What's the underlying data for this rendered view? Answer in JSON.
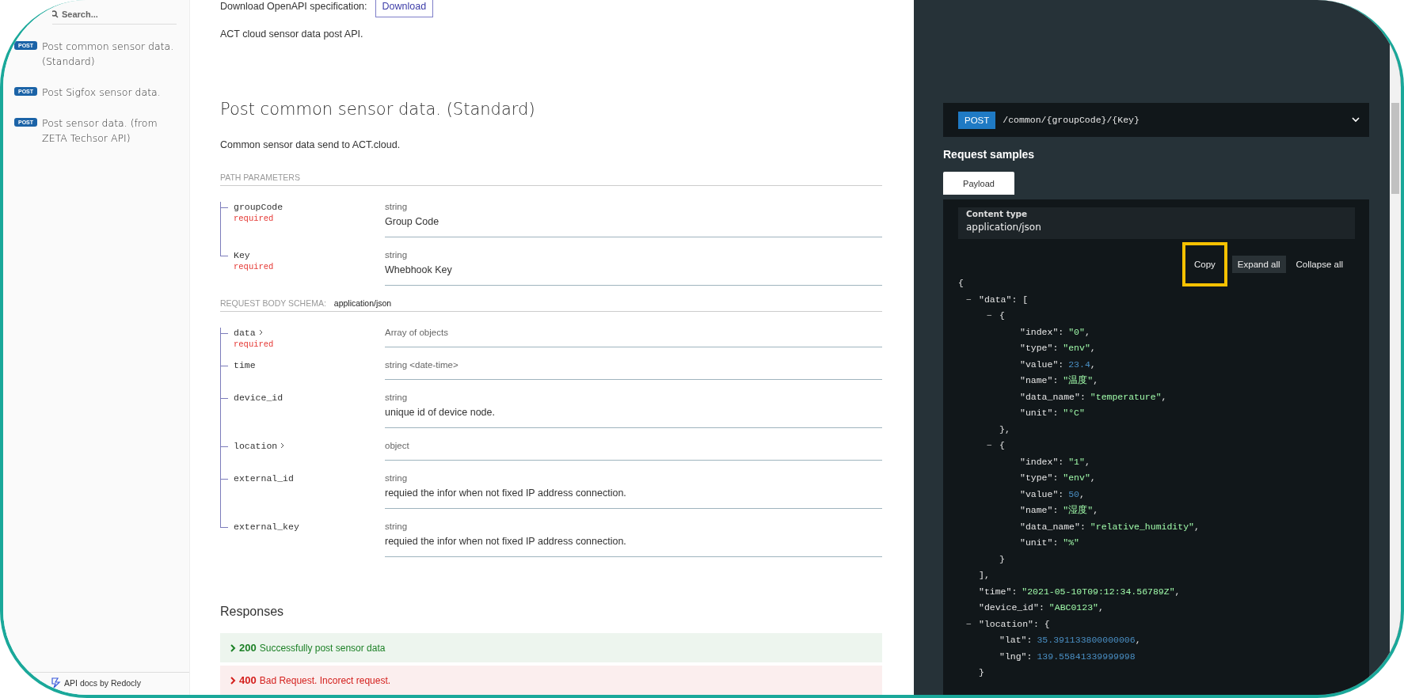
{
  "sidebar": {
    "search": {
      "placeholder": "Search..."
    },
    "items": [
      {
        "method": "POST",
        "label": "Post common sensor data. (Standard)",
        "selected": false
      },
      {
        "method": "POST",
        "label": "Post Sigfox sensor data.",
        "selected": false
      },
      {
        "method": "POST",
        "label": "Post sensor data. (from ZETA Techsor API)",
        "selected": false
      }
    ],
    "footer": "API docs by Redocly"
  },
  "main": {
    "download_label": "Download OpenAPI specification:",
    "download_button": "Download",
    "intro": "ACT cloud sensor data post API.",
    "operation_title": "Post common sensor data. (Standard)",
    "operation_description": "Common sensor data send to ACT.cloud.",
    "path_parameters": {
      "title": "PATH PARAMETERS",
      "params": [
        {
          "name": "groupCode",
          "required": true,
          "required_label": "required",
          "type": "string",
          "description": "Group Code",
          "expandable": false
        },
        {
          "name": "Key",
          "required": true,
          "required_label": "required",
          "type": "string",
          "description": "Whebhook Key",
          "expandable": false
        }
      ]
    },
    "body_schema": {
      "title": "REQUEST BODY SCHEMA:",
      "content_type": "application/json",
      "params": [
        {
          "name": "data",
          "required": true,
          "required_label": "required",
          "type": "Array of objects",
          "expandable": true
        },
        {
          "name": "time",
          "type": "string <date-time>",
          "expandable": false
        },
        {
          "name": "device_id",
          "type": "string",
          "description": "unique id of device node.",
          "expandable": false
        },
        {
          "name": "location",
          "type": "object",
          "expandable": true
        },
        {
          "name": "external_id",
          "type": "string",
          "description": "requied the infor when not fixed IP address connection.",
          "expandable": false
        },
        {
          "name": "external_key",
          "type": "string",
          "description": "requied the infor when not fixed IP address connection.",
          "expandable": false
        }
      ]
    },
    "responses": {
      "title": "Responses",
      "items": [
        {
          "kind": "success",
          "code": "200",
          "text": "Successfully post sensor data"
        },
        {
          "kind": "error",
          "code": "400",
          "text": "Bad Request. Incorect request."
        }
      ]
    }
  },
  "panel": {
    "endpoint": {
      "method": "POST",
      "path": "/common/{groupCode}/{Key}"
    },
    "samples_title": "Request samples",
    "tabs": [
      {
        "label": "Payload",
        "selected": true
      }
    ],
    "content_type_label": "Content type",
    "content_type": "application/json",
    "actions": [
      {
        "label": "Copy",
        "highlighted": true
      },
      {
        "label": "Expand all",
        "highlighted": false
      },
      {
        "label": "Collapse all",
        "highlighted": false
      }
    ],
    "code": {
      "open": "{",
      "children": [
        {
          "toggle": "−",
          "open": "\"data\": [",
          "close": "],",
          "children": [
            {
              "toggle": "−",
              "open": "{",
              "close": "},",
              "children": [
                {
                  "key": "\"index\":",
                  "value": "\"0\"",
                  "kind": "string",
                  "trail": ","
                },
                {
                  "key": "\"type\":",
                  "value": "\"env\"",
                  "kind": "string",
                  "trail": ","
                },
                {
                  "key": "\"value\":",
                  "value": "23.4",
                  "kind": "number",
                  "trail": ","
                },
                {
                  "key": "\"name\":",
                  "value": "\"温度\"",
                  "kind": "string",
                  "trail": ","
                },
                {
                  "key": "\"data_name\":",
                  "value": "\"temperature\"",
                  "kind": "string",
                  "trail": ","
                },
                {
                  "key": "\"unit\":",
                  "value": "\"°C\"",
                  "kind": "string"
                }
              ]
            },
            {
              "toggle": "−",
              "open": "{",
              "close": "}",
              "children": [
                {
                  "key": "\"index\":",
                  "value": "\"1\"",
                  "kind": "string",
                  "trail": ","
                },
                {
                  "key": "\"type\":",
                  "value": "\"env\"",
                  "kind": "string",
                  "trail": ","
                },
                {
                  "key": "\"value\":",
                  "value": "50",
                  "kind": "number",
                  "trail": ","
                },
                {
                  "key": "\"name\":",
                  "value": "\"湿度\"",
                  "kind": "string",
                  "trail": ","
                },
                {
                  "key": "\"data_name\":",
                  "value": "\"relative_humidity\"",
                  "kind": "string",
                  "trail": ","
                },
                {
                  "key": "\"unit\":",
                  "value": "\"%\"",
                  "kind": "string"
                }
              ]
            }
          ]
        },
        {
          "key": "\"time\":",
          "value": "\"2021-05-10T09:12:34.56789Z\"",
          "kind": "string",
          "trail": ","
        },
        {
          "key": "\"device_id\":",
          "value": "\"ABC0123\"",
          "kind": "string",
          "trail": ","
        },
        {
          "toggle": "−",
          "open": "\"location\": {",
          "close": "}",
          "children": [
            {
              "key": "\"lat\":",
              "value": "35.391133800000006",
              "kind": "number",
              "trail": ","
            },
            {
              "key": "\"lng\":",
              "value": "139.55841339999998",
              "kind": "number"
            }
          ]
        }
      ]
    }
  }
}
